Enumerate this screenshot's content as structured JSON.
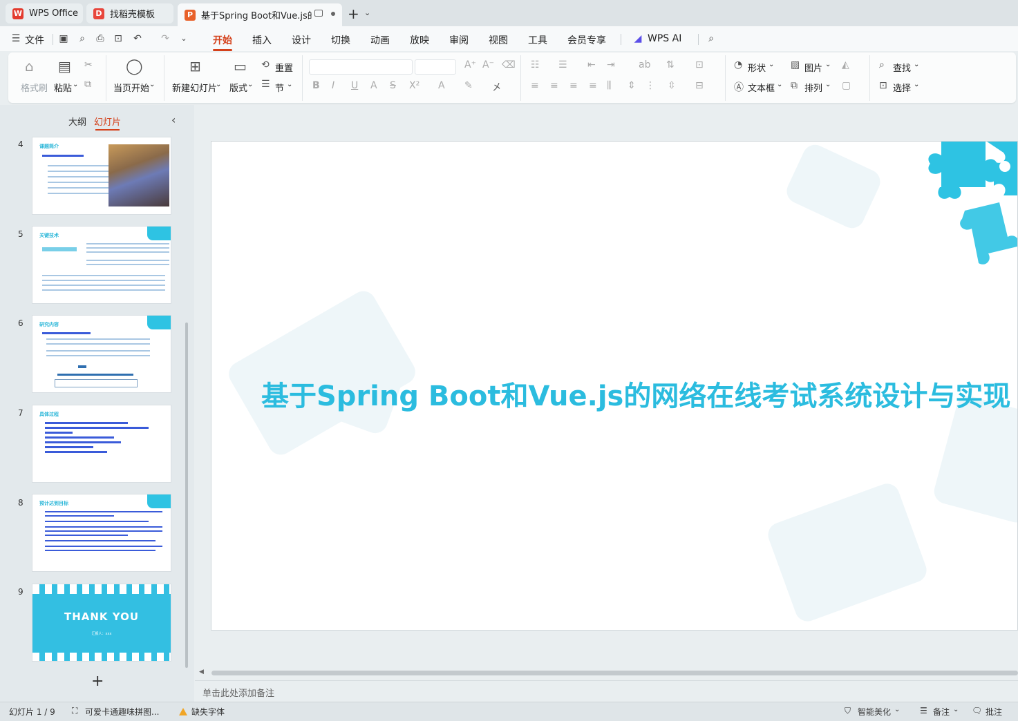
{
  "tabs": {
    "wps": "WPS Office",
    "find": "找稻壳模板",
    "doc": "基于Spring Boot和Vue.js的网络在线考试系统设计与实现",
    "doc_icon": "P",
    "add": "+",
    "more": "⌄"
  },
  "menu": {
    "file": "文件",
    "items": [
      "开始",
      "插入",
      "设计",
      "切换",
      "动画",
      "放映",
      "审阅",
      "视图",
      "工具",
      "会员专享"
    ],
    "wps_ai": "WPS AI"
  },
  "ribbon": {
    "format_painter": "格式刷",
    "paste": "粘贴",
    "start_from_current": "当页开始",
    "new_slide": "新建幻灯片",
    "layout": "版式",
    "reset": "重置",
    "section": "节",
    "shape": "形状",
    "picture": "图片",
    "textbox": "文本框",
    "arrange": "排列",
    "find": "查找",
    "select": "选择"
  },
  "left_panel": {
    "outline_tab": "大纲",
    "slides_tab": "幻灯片",
    "thumbnails": [
      {
        "num": "4",
        "title": "课题简介"
      },
      {
        "num": "5",
        "title": "关键技术"
      },
      {
        "num": "6",
        "title": "研究内容"
      },
      {
        "num": "7",
        "title": "具体过程"
      },
      {
        "num": "8",
        "title": "预计达到目标"
      },
      {
        "num": "9",
        "title": "THANK YOU",
        "sub": "汇报人：xxx"
      }
    ],
    "add": "+"
  },
  "slide": {
    "title": "基于Spring Boot和Vue.js的网络在线考试系统设计与实现"
  },
  "notes_placeholder": "单击此处添加备注",
  "status": {
    "slide_count": "幻灯片 1 / 9",
    "theme": "可爱卡通趣味拼图...",
    "missing_font": "缺失字体",
    "smart_beautify": "智能美化",
    "notes": "备注",
    "comments": "批注"
  },
  "colors": {
    "accent": "#d4411b",
    "slide_title": "#2bbcdf",
    "puzzle": "#2ec3e3"
  }
}
